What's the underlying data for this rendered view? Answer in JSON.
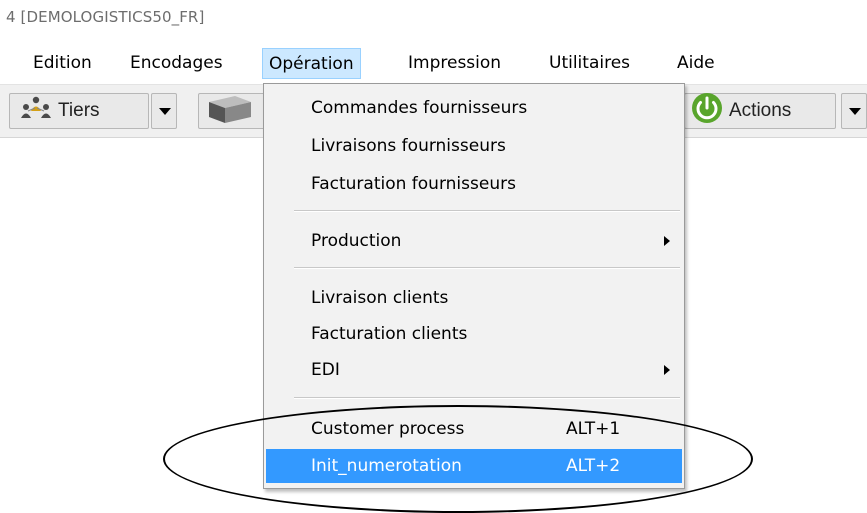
{
  "window": {
    "title": "4 [DEMOLOGISTICS50_FR]"
  },
  "menubar": {
    "items": [
      {
        "label": "Edition"
      },
      {
        "label": "Encodages"
      },
      {
        "label": "Opération"
      },
      {
        "label": "Impression"
      },
      {
        "label": "Utilitaires"
      },
      {
        "label": "Aide"
      }
    ],
    "active_item": "Opération"
  },
  "toolbar": {
    "tiers_label": "Tiers",
    "actions_label": "Actions",
    "icons": [
      "people-icon",
      "box-icon",
      "power-icon"
    ]
  },
  "dropdown": {
    "groups": [
      [
        {
          "label": "Commandes fournisseurs"
        },
        {
          "label": "Livraisons fournisseurs"
        },
        {
          "label": "Facturation fournisseurs"
        }
      ],
      [
        {
          "label": "Production",
          "submenu": true
        }
      ],
      [
        {
          "label": "Livraison clients"
        },
        {
          "label": "Facturation clients"
        },
        {
          "label": "EDI",
          "submenu": true
        }
      ],
      [
        {
          "label": "Customer process",
          "shortcut": "ALT+1"
        },
        {
          "label": "Init_numerotation",
          "shortcut": "ALT+2",
          "highlighted": true
        }
      ]
    ]
  },
  "colors": {
    "highlight": "#3399ff",
    "menu_active_bg": "#cce8ff",
    "menu_active_border": "#99d1ff",
    "annotation_ellipse": "#000000"
  }
}
